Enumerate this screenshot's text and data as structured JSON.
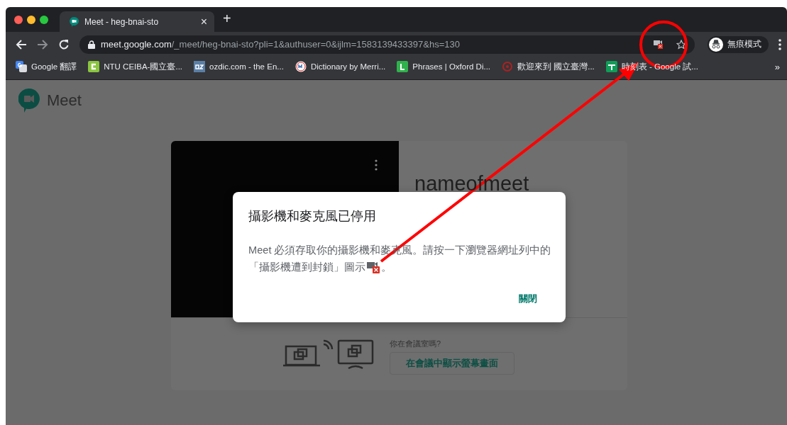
{
  "browser": {
    "tab": {
      "title": "Meet - heg-bnai-sto",
      "close": "×"
    },
    "new_tab": "+",
    "url": {
      "domain": "meet.google.com",
      "path": "/_meet/heg-bnai-sto?pli=1&authuser=0&ijlm=1583139433397&hs=130"
    },
    "profile": {
      "label": "無痕模式"
    },
    "bookmarks": [
      {
        "label": "Google 翻譯",
        "kind": "translate"
      },
      {
        "label": "NTU CEIBA-國立臺...",
        "kind": "ceiba"
      },
      {
        "label": "ozdic.com - the En...",
        "kind": "ozdic"
      },
      {
        "label": "Dictionary by Merri...",
        "kind": "mw"
      },
      {
        "label": "Phrases | Oxford Di...",
        "kind": "letter"
      },
      {
        "label": "歡迎來到 國立臺灣...",
        "kind": "ntu"
      },
      {
        "label": "時刻表 - Google 試...",
        "kind": "sheets"
      }
    ],
    "bookmarks_overflow": "»"
  },
  "page": {
    "app_name": "Meet",
    "meeting_name": "nameofmeet",
    "question": "你在會議室嗎?",
    "present_button": "在會議中顯示螢幕畫面"
  },
  "dialog": {
    "title": "攝影機和麥克風已停用",
    "message_line1": "Meet 必須存取你的攝影機和麥克風。請按一下瀏覽器網址列中的",
    "message_line2": "「攝影機遭到封鎖」圖示",
    "message_end": "。",
    "close_button": "關閉"
  }
}
